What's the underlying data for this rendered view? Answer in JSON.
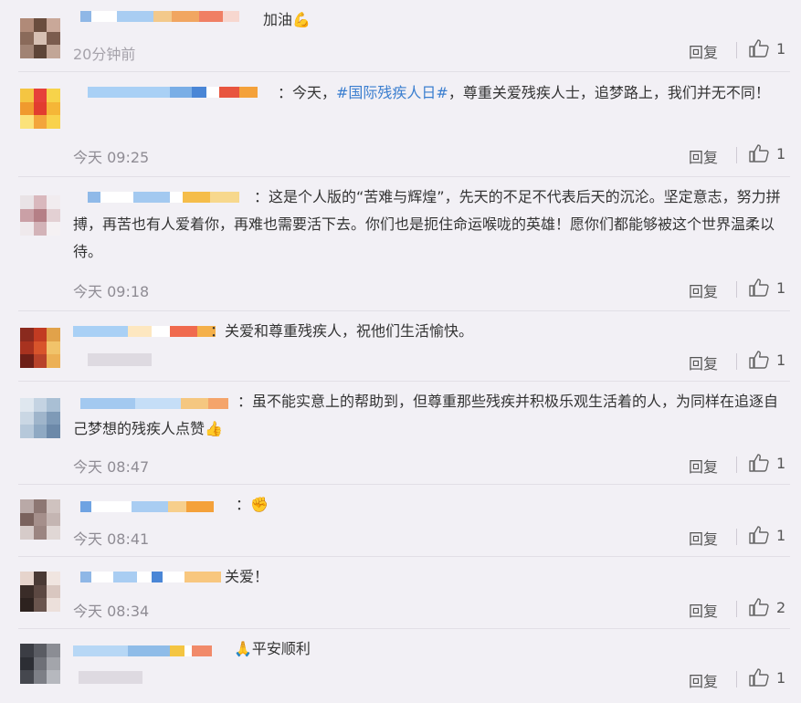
{
  "reply_label": "回复",
  "comments": [
    {
      "text_prefix": "",
      "hashtag": "",
      "text": "加油💪",
      "time": "20分钟前",
      "likes": "1"
    },
    {
      "text_prefix": "：今天，",
      "hashtag": "#国际残疾人日#",
      "text": "，尊重关爱残疾人士，追梦路上，我们并无不同！",
      "time": "今天 09:25",
      "likes": "1"
    },
    {
      "text_prefix": "",
      "hashtag": "",
      "text": "：这是个人版的“苦难与辉煌”，先天的不足不代表后天的沉沦。坚定意志，努力拼搏，再苦也有人爱着你，再难也需要活下去。你们也是扼住命运喉咙的英雄！愿你们都能够被这个世界温柔以待。",
      "time": "今天 09:18",
      "likes": "1"
    },
    {
      "text_prefix": "",
      "hashtag": "",
      "text": "：关爱和尊重残疾人，祝他们生活愉快。",
      "time": "",
      "likes": "1"
    },
    {
      "text_prefix": "",
      "hashtag": "",
      "text": "：虽不能实意上的帮助到，但尊重那些残疾并积极乐观生活着的人，为同样在追逐自己梦想的残疾人点赞👍",
      "time": "今天 08:47",
      "likes": "1"
    },
    {
      "text_prefix": "",
      "hashtag": "",
      "text": "：✊",
      "time": "今天 08:41",
      "likes": "1"
    },
    {
      "text_prefix": "",
      "hashtag": "",
      "text": "关爱！",
      "time": "今天 08:34",
      "likes": "2"
    },
    {
      "text_prefix": "",
      "hashtag": "",
      "text": "🙏平安顺利",
      "time": "",
      "likes": "1"
    }
  ]
}
